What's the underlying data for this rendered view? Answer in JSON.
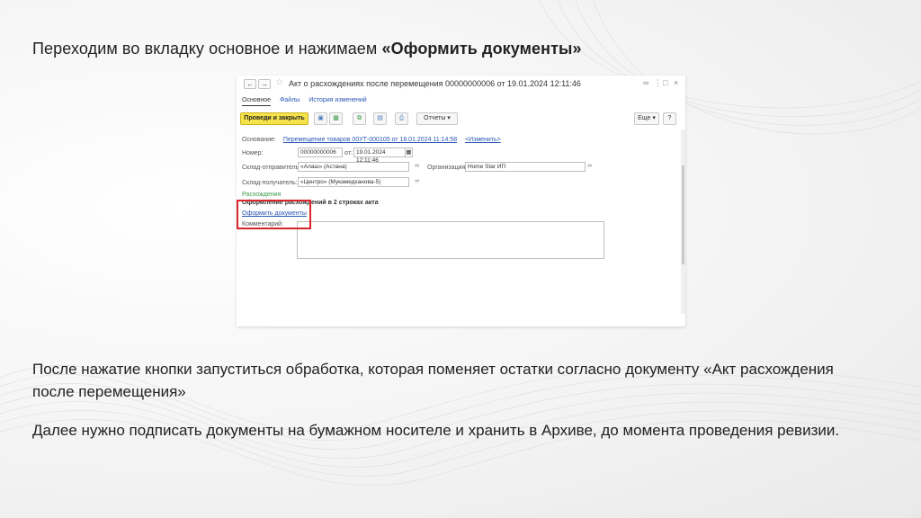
{
  "slide": {
    "heading_plain": "Переходим во вкладку основное и нажимаем ",
    "heading_bold": "«Оформить документы»",
    "paragraph1": "После нажатие кнопки запуститься обработка, которая поменяет остатки согласно документу «Акт расхождения после перемещения»",
    "paragraph2": "Далее нужно подписать документы на бумажном носителе и хранить в Архиве, до момента проведения ревизии."
  },
  "window": {
    "title": "Акт о расхождениях после перемещения 00000000006 от 19.01.2024 12:11:46",
    "back": "←",
    "forward": "→",
    "star": "☆",
    "link_icon": "🔗",
    "menu_icon": "⋮",
    "max_icon": "□",
    "close_icon": "×",
    "tabs": [
      "Основное",
      "Файлы",
      "История изменений"
    ],
    "toolbar": {
      "post_close": "Проведи и закрыть",
      "reports": "Отчеты",
      "more": "Еще",
      "help": "?"
    },
    "form": {
      "basis_label": "Основание:",
      "basis_value": "Перемещение товаров 00УТ-000105 от 18.01.2024 11:14:58",
      "change_link": "<Изменить>",
      "number_label": "Номер:",
      "number_value": "00000000006",
      "date_label": "от:",
      "date_value": "19.01.2024 12:11:46",
      "sender_label": "Склад-отправитель:",
      "sender_value": "«Алаш» (Астана)",
      "org_label": "Организация:",
      "org_value": "Home Star ИП",
      "receiver_label": "Склад-получатель:",
      "receiver_value": "«Центро» (Мукамедханова-5)",
      "section": "Расхождения",
      "discrepancy_text": "Оформление расхождений в 2 строках акта",
      "make_docs_link": "Оформить документы",
      "comment_label": "Комментарий:"
    }
  },
  "colors": {
    "primary_button": "#f6e24a",
    "link": "#2a58b4",
    "section": "#3a9a4a",
    "highlight": "#d9252b"
  }
}
